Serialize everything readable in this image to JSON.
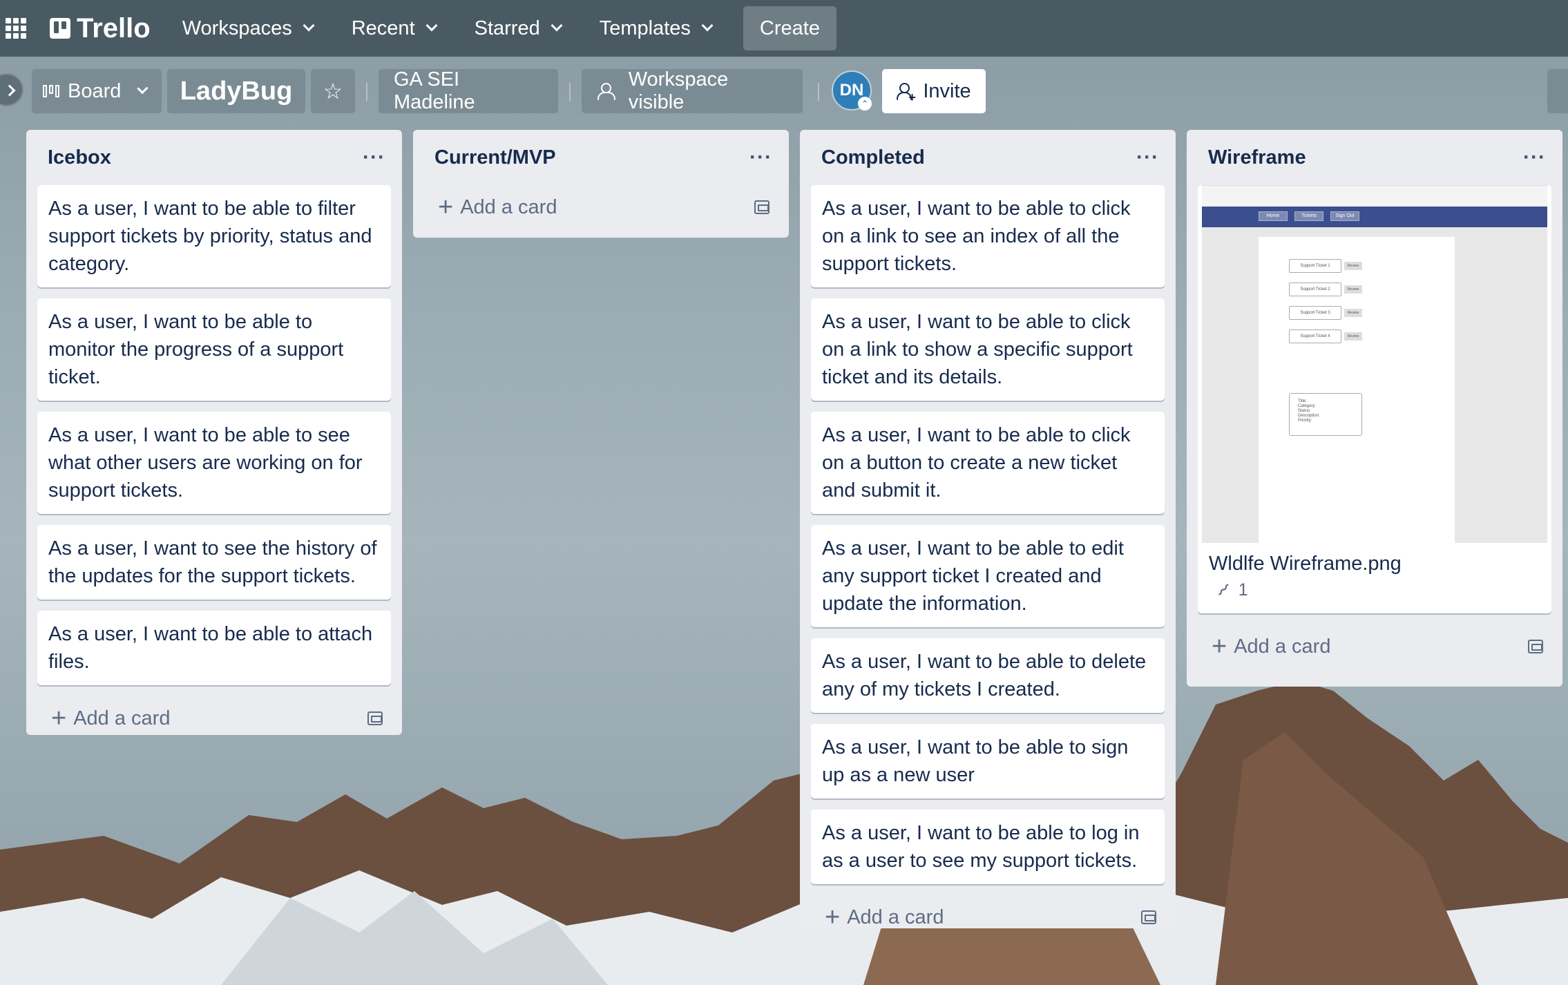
{
  "topnav": {
    "brand": "Trello",
    "items": [
      {
        "label": "Workspaces"
      },
      {
        "label": "Recent"
      },
      {
        "label": "Starred"
      },
      {
        "label": "Templates"
      }
    ],
    "create_label": "Create"
  },
  "boardbar": {
    "view_label": "Board",
    "board_title": "LadyBug",
    "star_glyph": "☆",
    "workspace_label": "GA SEI Madeline",
    "visibility_label": "Workspace visible",
    "avatar_initials": "DN",
    "avatar_badge": "⌃",
    "invite_label": "Invite"
  },
  "lists": [
    {
      "title": "Icebox",
      "menu": "···",
      "cards": [
        "As a user, I want to be able to filter support tickets by priority, status and category.",
        "As a user, I want to be able to monitor the progress of a support ticket.",
        "As a user, I want to be able to see what other users are working on for support tickets.",
        "As a user, I want to see the history of the updates for the support tickets.",
        "As a user, I want to be able to attach files."
      ],
      "add_label": "Add a card"
    },
    {
      "title": "Current/MVP",
      "menu": "···",
      "cards": [],
      "add_label": "Add a card"
    },
    {
      "title": "Completed",
      "menu": "···",
      "cards": [
        "As a user, I want to be able to click on a link to see an index of all the support tickets.",
        "As a user, I want to be able to click on a link to show a specific support ticket and its details.",
        "As a user, I want to be able to click on a button to create a new ticket and submit it.",
        "As a user, I want to be able to edit any support ticket I created and update the information.",
        "As a user, I want to be able to delete any of my tickets I created.",
        "As a user, I want to be able to sign up as a new user",
        "As a user, I want to be able to log in as a user to see my support tickets."
      ],
      "add_label": "Add a card"
    },
    {
      "title": "Wireframe",
      "menu": "···",
      "attachment_card": {
        "name": "Wldlfe Wireframe.png",
        "attachment_count": "1",
        "thumb": {
          "nav": [
            "Home",
            "Tickets",
            "Sign Out"
          ],
          "tickets": [
            "Support Ticket 1",
            "Support Ticket 2",
            "Support Ticket 3",
            "Support Ticket 4"
          ],
          "review": "Review",
          "detail_fields": [
            "Title:",
            "Category:",
            "Status:",
            "Description:",
            "Priority:"
          ]
        }
      },
      "add_label": "Add a card"
    }
  ]
}
